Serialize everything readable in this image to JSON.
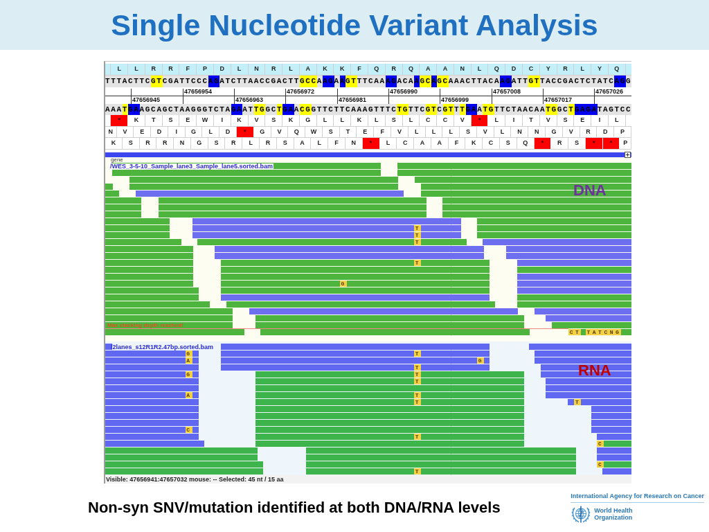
{
  "slide": {
    "title": "Single Nucleotide Variant Analysis"
  },
  "browser": {
    "amino_acids": [
      "L",
      "L",
      "R",
      "R",
      "F",
      "P",
      "D",
      "L",
      "N",
      "R",
      "L",
      "A",
      "K",
      "K",
      "F",
      "Q",
      "R",
      "Q",
      "A",
      "A",
      "N",
      "L",
      "Q",
      "D",
      "C",
      "Y",
      "R",
      "L",
      "Y",
      "Q"
    ],
    "sequence_top": [
      {
        "bases": "TTTACTTC"
      },
      {
        "bases": "GT",
        "color": "#ffff00"
      },
      {
        "bases": "CGATTCCC"
      },
      {
        "bases": "AG",
        "color": "#0000f0"
      },
      {
        "bases": "ATCTTAACCGACTT"
      },
      {
        "bases": "GCC",
        "color": "#ffff00"
      },
      {
        "bases": "A"
      },
      {
        "bases": "AG",
        "color": "#0000f0"
      },
      {
        "bases": "A"
      },
      {
        "bases": "A",
        "color": "#0000f0"
      },
      {
        "bases": "GT",
        "color": "#ffff00"
      },
      {
        "bases": "TTCAA"
      },
      {
        "bases": "AG",
        "color": "#0000f0"
      },
      {
        "bases": "ACA"
      },
      {
        "bases": "A",
        "color": "#0000f0"
      },
      {
        "bases": "GC",
        "color": "#ffff00"
      },
      {
        "bases": "A",
        "color": "#0000f0"
      },
      {
        "bases": "GC",
        "color": "#ffff00"
      },
      {
        "bases": "AAACTTACA"
      },
      {
        "bases": "AG",
        "color": "#0000f0"
      },
      {
        "bases": "ATT"
      },
      {
        "bases": "GT",
        "color": "#ffff00"
      },
      {
        "bases": "TACCGACTCTATC"
      },
      {
        "bases": "AG",
        "color": "#0000f0"
      },
      {
        "bases": "G"
      }
    ],
    "ruler": {
      "upper": [
        "47656954",
        "47656972",
        "47656990",
        "47657008",
        "47657026"
      ],
      "lower": [
        "47656945",
        "47656963",
        "47656981",
        "47656999",
        "47657017"
      ]
    },
    "sequence_bottom": [
      {
        "bases": "AAA"
      },
      {
        "bases": "T",
        "color": "#ffff00"
      },
      {
        "bases": "GA",
        "color": "#0000f0"
      },
      {
        "bases": "AGCAGCTAAGGGTCTA"
      },
      {
        "bases": "GA",
        "color": "#0000f0"
      },
      {
        "bases": "AT"
      },
      {
        "bases": "TG",
        "color": "#ffff00"
      },
      {
        "bases": "GC"
      },
      {
        "bases": "T",
        "color": "#ffff00"
      },
      {
        "bases": "GA",
        "color": "#0000f0"
      },
      {
        "bases": "A"
      },
      {
        "bases": "CG",
        "color": "#ffff00"
      },
      {
        "bases": "GTTCTTCAAAGTTTC"
      },
      {
        "bases": "TG",
        "color": "#ffff00"
      },
      {
        "bases": "TTC"
      },
      {
        "bases": "GT",
        "color": "#ffff00"
      },
      {
        "bases": "C"
      },
      {
        "bases": "GT",
        "color": "#ffff00"
      },
      {
        "bases": "T"
      },
      {
        "bases": "T",
        "color": "#ffff00"
      },
      {
        "bases": "GA",
        "color": "#0000f0"
      },
      {
        "bases": "A"
      },
      {
        "bases": "TG",
        "color": "#ffff00"
      },
      {
        "bases": "TTCTAACAA"
      },
      {
        "bases": "TG",
        "color": "#ffff00"
      },
      {
        "bases": "GC"
      },
      {
        "bases": "T",
        "color": "#ffff00"
      },
      {
        "bases": "GAGA",
        "color": "#0000f0"
      },
      {
        "bases": "TAGTCC"
      }
    ],
    "translation_frames": [
      [
        {
          "aa": "*",
          "stop": true
        },
        {
          "aa": "K",
          "stop": false
        },
        {
          "aa": "T",
          "stop": false
        },
        {
          "aa": "S",
          "stop": false
        },
        {
          "aa": "E",
          "stop": false
        },
        {
          "aa": "W",
          "stop": false
        },
        {
          "aa": "I",
          "stop": false
        },
        {
          "aa": "K",
          "stop": false
        },
        {
          "aa": "V",
          "stop": false
        },
        {
          "aa": "S",
          "stop": false
        },
        {
          "aa": "K",
          "stop": false
        },
        {
          "aa": "G",
          "stop": false
        },
        {
          "aa": "L",
          "stop": false
        },
        {
          "aa": "L",
          "stop": false
        },
        {
          "aa": "K",
          "stop": false
        },
        {
          "aa": "L",
          "stop": false
        },
        {
          "aa": "S",
          "stop": false
        },
        {
          "aa": "L",
          "stop": false
        },
        {
          "aa": "C",
          "stop": false
        },
        {
          "aa": "C",
          "stop": false
        },
        {
          "aa": "V",
          "stop": false
        },
        {
          "aa": "*",
          "stop": true
        },
        {
          "aa": "L",
          "stop": false
        },
        {
          "aa": "I",
          "stop": false
        },
        {
          "aa": "T",
          "stop": false
        },
        {
          "aa": "V",
          "stop": false
        },
        {
          "aa": "S",
          "stop": false
        },
        {
          "aa": "E",
          "stop": false
        },
        {
          "aa": "I",
          "stop": false
        },
        {
          "aa": "L",
          "stop": false
        }
      ],
      [
        {
          "aa": "N",
          "stop": false
        },
        {
          "aa": "V",
          "stop": false
        },
        {
          "aa": "E",
          "stop": false
        },
        {
          "aa": "D",
          "stop": false
        },
        {
          "aa": "I",
          "stop": false
        },
        {
          "aa": "G",
          "stop": false
        },
        {
          "aa": "L",
          "stop": false
        },
        {
          "aa": "D",
          "stop": false
        },
        {
          "aa": "*",
          "stop": true
        },
        {
          "aa": "G",
          "stop": false
        },
        {
          "aa": "V",
          "stop": false
        },
        {
          "aa": "Q",
          "stop": false
        },
        {
          "aa": "W",
          "stop": false
        },
        {
          "aa": "S",
          "stop": false
        },
        {
          "aa": "T",
          "stop": false
        },
        {
          "aa": "E",
          "stop": false
        },
        {
          "aa": "F",
          "stop": false
        },
        {
          "aa": "V",
          "stop": false
        },
        {
          "aa": "L",
          "stop": false
        },
        {
          "aa": "L",
          "stop": false
        },
        {
          "aa": "L",
          "stop": false
        },
        {
          "aa": "S",
          "stop": false
        },
        {
          "aa": "V",
          "stop": false
        },
        {
          "aa": "L",
          "stop": false
        },
        {
          "aa": "N",
          "stop": false
        },
        {
          "aa": "N",
          "stop": false
        },
        {
          "aa": "G",
          "stop": false
        },
        {
          "aa": "V",
          "stop": false
        },
        {
          "aa": "R",
          "stop": false
        },
        {
          "aa": "D",
          "stop": false
        },
        {
          "aa": "P",
          "stop": false
        }
      ],
      [
        {
          "aa": "K",
          "stop": false
        },
        {
          "aa": "S",
          "stop": false
        },
        {
          "aa": "R",
          "stop": false
        },
        {
          "aa": "R",
          "stop": false
        },
        {
          "aa": "N",
          "stop": false
        },
        {
          "aa": "G",
          "stop": false
        },
        {
          "aa": "S",
          "stop": false
        },
        {
          "aa": "R",
          "stop": false
        },
        {
          "aa": "L",
          "stop": false
        },
        {
          "aa": "R",
          "stop": false
        },
        {
          "aa": "S",
          "stop": false
        },
        {
          "aa": "A",
          "stop": false
        },
        {
          "aa": "L",
          "stop": false
        },
        {
          "aa": "F",
          "stop": false
        },
        {
          "aa": "N",
          "stop": false
        },
        {
          "aa": "*",
          "stop": true
        },
        {
          "aa": "L",
          "stop": false
        },
        {
          "aa": "C",
          "stop": false
        },
        {
          "aa": "A",
          "stop": false
        },
        {
          "aa": "A",
          "stop": false
        },
        {
          "aa": "F",
          "stop": false
        },
        {
          "aa": "K",
          "stop": false
        },
        {
          "aa": "C",
          "stop": false
        },
        {
          "aa": "S",
          "stop": false
        },
        {
          "aa": "Q",
          "stop": false
        },
        {
          "aa": "*",
          "stop": true
        },
        {
          "aa": "R",
          "stop": false
        },
        {
          "aa": "S",
          "stop": false
        },
        {
          "aa": "*",
          "stop": true
        },
        {
          "aa": "*",
          "stop": true
        },
        {
          "aa": "P",
          "stop": false
        }
      ]
    ],
    "gene_track": "gene",
    "dna_track": {
      "file": "/WES_3-5-10_Sample_lane3_Sample_lane5.sorted.bam",
      "tag": "DNA",
      "mismatches": [
        "T",
        "T",
        "T",
        "T",
        "G",
        "CT",
        "TATCNG"
      ],
      "warning": "Max stacking depth reached!"
    },
    "rna_track": {
      "file": "/2lanes_s12R1R2.47bp.sorted.bam",
      "tag": "RNA",
      "mismatches": [
        "G",
        "T",
        "A",
        "G",
        "T",
        "G",
        "T",
        "T",
        "A",
        "T",
        "T",
        "T",
        "C",
        "T",
        "C",
        "C",
        "T"
      ]
    },
    "status": "Visible: 47656941:47657032 mouse: -- Selected: 45 nt / 15 aa"
  },
  "caption": "Non-syn SNV/mutation identified at both DNA/RNA levels",
  "logo": {
    "agency": "International Agency for Research on Cancer",
    "organization": [
      "World Health",
      "Organization"
    ]
  }
}
